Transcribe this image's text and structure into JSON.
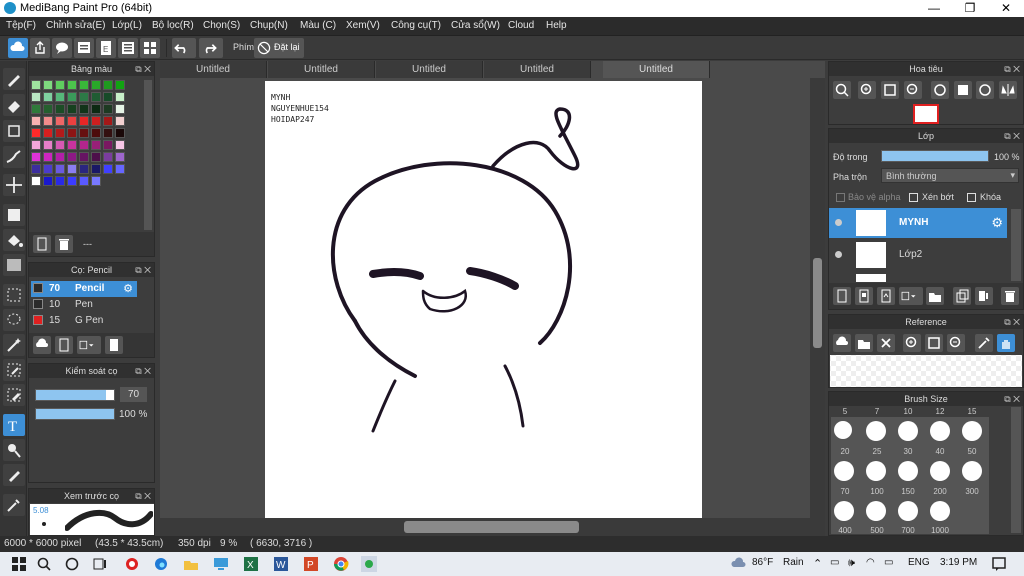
{
  "titlebar": {
    "title": "MediBang Paint Pro (64bit)",
    "minimize": "—",
    "maximize": "❐",
    "close": "✕"
  },
  "menu": [
    "Tệp(F)",
    "Chỉnh sửa(E)",
    "Lớp(L)",
    "Bộ lọc(R)",
    "Chọn(S)",
    "Chụp(N)",
    "Màu (C)",
    "Xem(V)",
    "Công cụ(T)",
    "Cửa sổ(W)",
    "Cloud",
    "Help"
  ],
  "toolbar": {
    "key_label": "Phím",
    "reset_label": "Đặt lại"
  },
  "tabs": [
    "Untitled",
    "Untitled",
    "Untitled",
    "Untitled",
    "Untitled"
  ],
  "palette": {
    "title": "Bảng màu",
    "footer_text": "---",
    "colors": [
      "#9fe39f",
      "#7fd87f",
      "#5fcc5f",
      "#4cc44c",
      "#39b839",
      "#29a829",
      "#1f9a1f",
      "#11a311",
      "#b9e7c3",
      "#7fd0a0",
      "#56b87a",
      "#3a9a5a",
      "#2c7a46",
      "#1f5c33",
      "#174a28",
      "#c7efc8",
      "#2f7a3a",
      "#255f2e",
      "#1c4d25",
      "#16411f",
      "#123419",
      "#0d2a13",
      "#1d3a22",
      "#e6f4e6",
      "#f7b3b3",
      "#f28c8c",
      "#ee6666",
      "#ea4040",
      "#e62626",
      "#cc1f1f",
      "#a31818",
      "#f2d0d0",
      "#ff2a2a",
      "#d81f1f",
      "#b31a1a",
      "#8c1414",
      "#661010",
      "#4d0c0c",
      "#331010",
      "#1a0808",
      "#f2a6d9",
      "#e67fc7",
      "#d659b3",
      "#c7339e",
      "#b3268c",
      "#991f78",
      "#7a1861",
      "#f7c6e6",
      "#e033d6",
      "#cc26bf",
      "#b31fa8",
      "#8c1985",
      "#661462",
      "#4d0f4a",
      "#7a3d9e",
      "#9e66cc",
      "#3c2e9e",
      "#4b3ccc",
      "#6a5ae0",
      "#8b7ef0",
      "#2a2680",
      "#1a1866",
      "#4040ff",
      "#6666ff",
      "#ffffff",
      "#1a18cc",
      "#2a2ae6",
      "#3c3cff",
      "#5a5aff",
      "#7878ff",
      "",
      ""
    ]
  },
  "brush_panel": {
    "title": "Cọ: Pencil",
    "brushes": [
      {
        "size": "70",
        "name": "Pencil",
        "color": "#2b2b2b"
      },
      {
        "size": "10",
        "name": "Pen",
        "color": "#2b2b2b"
      },
      {
        "size": "15",
        "name": "G Pen",
        "color": "#e02020"
      }
    ]
  },
  "brush_control": {
    "title": "Kiểm soát cọ",
    "size_value": "70",
    "opacity_value": "100 %",
    "size_fill": 0.9,
    "opacity_fill": 1.0
  },
  "brush_preview": {
    "title": "Xem trước cọ",
    "size_text": "5.08"
  },
  "canvas_note": [
    "MYNH",
    "NGUYENHUE154",
    "HOIDAP247"
  ],
  "navigator": {
    "title": "Hoa tiêu"
  },
  "layer_panel": {
    "title": "Lớp",
    "opacity_label": "Độ trong",
    "opacity_value": "100 %",
    "blend_label": "Pha trộn",
    "blend_value": "Bình thường",
    "protect_alpha": "Bảo vệ alpha",
    "clipping": "Xén bớt",
    "lock": "Khóa",
    "layers": [
      {
        "name": "MYNH",
        "active": true
      },
      {
        "name": "Lớp2",
        "active": false
      },
      {
        "name": "",
        "active": false
      }
    ]
  },
  "reference": {
    "title": "Reference"
  },
  "brush_size": {
    "title": "Brush Size",
    "top_row": [
      "5",
      "7",
      "10",
      "12",
      "15"
    ],
    "rows": [
      [
        "20",
        "25",
        "30",
        "40",
        "50"
      ],
      [
        "70",
        "100",
        "150",
        "200",
        "300"
      ],
      [
        "400",
        "500",
        "700",
        "1000"
      ]
    ]
  },
  "status": {
    "dimensions": "6000 * 6000 pixel",
    "physical": "(43.5 * 43.5cm)",
    "dpi": "350 dpi",
    "zoom": "9 %",
    "coords": "( 6630, 3716 )"
  },
  "taskbar": {
    "weather_temp": "86°F",
    "weather_text": "Rain",
    "lang": "ENG",
    "time": "3:19 PM"
  }
}
